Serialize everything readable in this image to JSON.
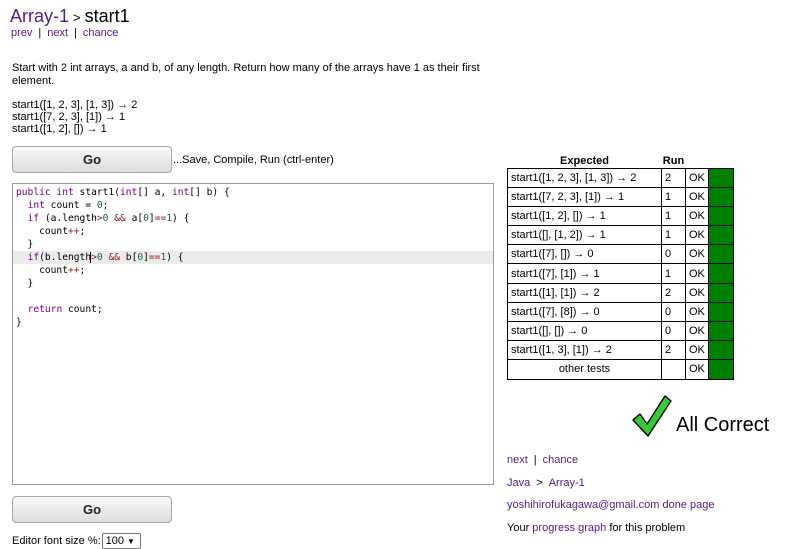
{
  "header": {
    "breadcrumb": "Array-1",
    "separator": ">",
    "title": "start1"
  },
  "nav": {
    "prev": "prev",
    "next": "next",
    "chance": "chance",
    "sep": "|"
  },
  "problem": {
    "description": "Start with 2 int arrays, a and b, of any length. Return how many of the arrays have 1 as their first element.",
    "examples": [
      "start1([1, 2, 3], [1, 3]) → 2",
      "start1([7, 2, 3], [1]) → 1",
      "start1([1, 2], []) → 1"
    ]
  },
  "buttons": {
    "go_top": "Go",
    "go_bottom": "Go",
    "run_hint": "...Save, Compile, Run (ctrl-enter)"
  },
  "results": {
    "col_expected": "Expected",
    "col_run": "Run",
    "rows": [
      {
        "expected": "start1([1, 2, 3], [1, 3]) → 2",
        "run": "2",
        "status": "OK"
      },
      {
        "expected": "start1([7, 2, 3], [1]) → 1",
        "run": "1",
        "status": "OK"
      },
      {
        "expected": "start1([1, 2], []) → 1",
        "run": "1",
        "status": "OK"
      },
      {
        "expected": "start1([], [1, 2]) → 1",
        "run": "1",
        "status": "OK"
      },
      {
        "expected": "start1([7], []) → 0",
        "run": "0",
        "status": "OK"
      },
      {
        "expected": "start1([7], [1]) → 1",
        "run": "1",
        "status": "OK"
      },
      {
        "expected": "start1([1], [1]) → 2",
        "run": "2",
        "status": "OK"
      },
      {
        "expected": "start1([7], [8]) → 0",
        "run": "0",
        "status": "OK"
      },
      {
        "expected": "start1([], []) → 0",
        "run": "0",
        "status": "OK"
      },
      {
        "expected": "start1([1, 3], [1]) → 2",
        "run": "2",
        "status": "OK"
      },
      {
        "expected": "other tests",
        "run": "",
        "status": "OK"
      }
    ],
    "pass_color": "#008000",
    "all_correct": "All Correct",
    "check_icon": "check-icon",
    "check_color": "#33cc33"
  },
  "footer": {
    "next": "next",
    "chance": "chance",
    "sep": "|",
    "lang": "Java",
    "lang_sep": ">",
    "section": "Array-1",
    "user_link": "yoshihirofukagawa@gmail.com done page",
    "progress_prefix": "Your",
    "progress_link": "progress graph",
    "progress_suffix": "for this problem"
  },
  "editor_settings": {
    "font_size_label": "Editor font size %:",
    "font_size_value": "100"
  }
}
